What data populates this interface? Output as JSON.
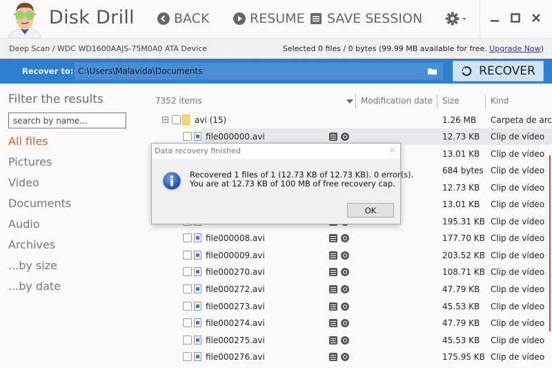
{
  "app": {
    "title": "Disk Drill"
  },
  "toolbar": {
    "back_label": "BACK",
    "resume_label": "RESUME",
    "save_session_label": "SAVE SESSION"
  },
  "status": {
    "breadcrumb": "Deep Scan / WDC WD1600AAJS-75M0A0 ATA Device",
    "selection_info": "Selected 0 files / 0 bytes (99.99 MB available for free. ",
    "upgrade_link": "Upgrade Now",
    "selection_suffix": ")"
  },
  "recover_bar": {
    "label": "Recover to:",
    "path": "C:\\Users\\Malavida\\Documents",
    "button_label": "RECOVER"
  },
  "sidebar": {
    "title": "Filter the results",
    "search_placeholder": "search by name...",
    "items": [
      {
        "label": "All files",
        "active": true
      },
      {
        "label": "Pictures",
        "active": false
      },
      {
        "label": "Video",
        "active": false
      },
      {
        "label": "Documents",
        "active": false
      },
      {
        "label": "Audio",
        "active": false
      },
      {
        "label": "Archives",
        "active": false
      },
      {
        "label": "...by size",
        "active": false
      },
      {
        "label": "...by date",
        "active": false
      }
    ]
  },
  "list": {
    "item_count": "7352 items",
    "columns": {
      "modification_date": "Modification date",
      "size": "Size",
      "kind": "Kind"
    },
    "folder": {
      "name": "avi (15)",
      "size": "1.26 MB",
      "kind": "Carpeta de arc..."
    },
    "files": [
      {
        "name": "file000000.avi",
        "size": "12.73 KB",
        "kind": "Clip de vídeo",
        "selected": true
      },
      {
        "name": "",
        "size": "13.01 KB",
        "kind": "Clip de vídeo"
      },
      {
        "name": "",
        "size": "684 bytes",
        "kind": "Clip de vídeo"
      },
      {
        "name": "",
        "size": "12.73 KB",
        "kind": "Clip de vídeo"
      },
      {
        "name": "",
        "size": "13.01 KB",
        "kind": "Clip de vídeo"
      },
      {
        "name": "",
        "size": "195.31 KB",
        "kind": "Clip de vídeo"
      },
      {
        "name": "file000008.avi",
        "size": "177.70 KB",
        "kind": "Clip de vídeo"
      },
      {
        "name": "file000009.avi",
        "size": "203.52 KB",
        "kind": "Clip de vídeo"
      },
      {
        "name": "file000270.avi",
        "size": "108.71 KB",
        "kind": "Clip de vídeo"
      },
      {
        "name": "file000272.avi",
        "size": "47.79 KB",
        "kind": "Clip de vídeo"
      },
      {
        "name": "file000273.avi",
        "size": "45.53 KB",
        "kind": "Clip de vídeo"
      },
      {
        "name": "file000274.avi",
        "size": "47.79 KB",
        "kind": "Clip de vídeo"
      },
      {
        "name": "file000275.avi",
        "size": "45.53 KB",
        "kind": "Clip de vídeo"
      },
      {
        "name": "file000276.avi",
        "size": "175.95 KB",
        "kind": "Clip de vídeo"
      }
    ]
  },
  "dialog": {
    "title": "Data recovery finished",
    "close_label": "✕",
    "message_line1": "Recovered 1 files of 1 (12.73 KB of 12.73 KB). 0 error(s).",
    "message_line2": "You are at 12.73 KB of 100 MB of free recovery cap.",
    "ok_label": "OK",
    "icon": "info-icon"
  },
  "colors": {
    "accent_blue": "#2f7ed0",
    "active_filter": "#d95a2a",
    "scrollbar": "#b5512e"
  }
}
